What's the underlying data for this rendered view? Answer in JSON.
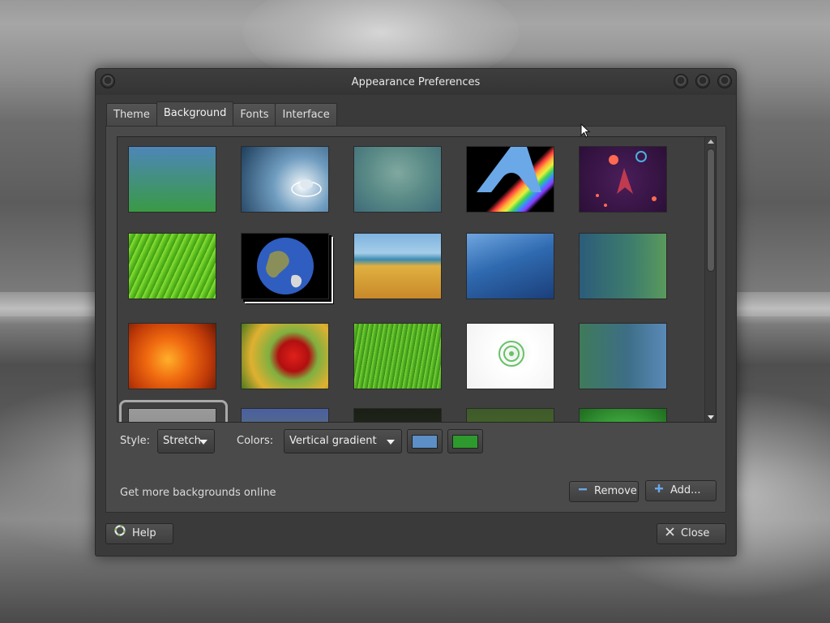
{
  "window": {
    "title": "Appearance Preferences"
  },
  "tabs": [
    {
      "label": "Theme",
      "active": false
    },
    {
      "label": "Background",
      "active": true
    },
    {
      "label": "Fonts",
      "active": false
    },
    {
      "label": "Interface",
      "active": false
    }
  ],
  "wallpapers": [
    "blue-green-gradient",
    "water-droplet",
    "teal-blur",
    "arch-rainbow",
    "purple-space-rocket",
    "green-leaf",
    "earth-globe",
    "wheat-field-sea",
    "blue-waves",
    "teal-dots",
    "orange-flower",
    "red-flower",
    "green-grass",
    "white-logo",
    "teal-blue-gradient",
    "grey-cloud",
    "bluebells",
    "dark-green",
    "green-soft",
    "green-leaves"
  ],
  "options": {
    "style_label": "Style:",
    "style_value": "Stretch",
    "colors_label": "Colors:",
    "colors_value": "Vertical gradient",
    "primary_color": "#5b8fc6",
    "secondary_color": "#2e9a2e"
  },
  "actions": {
    "more_online": "Get more backgrounds online",
    "remove": "Remove",
    "add": "Add..."
  },
  "footer": {
    "help": "Help",
    "close": "Close"
  }
}
